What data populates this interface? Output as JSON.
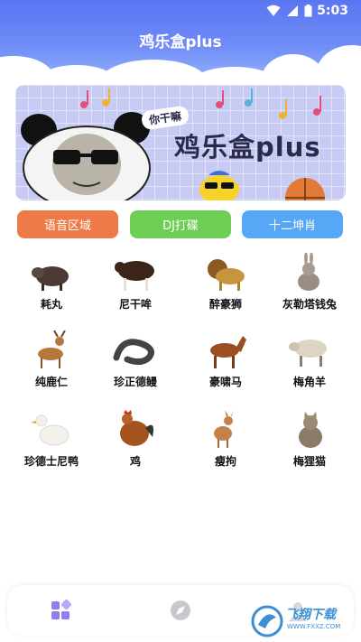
{
  "status": {
    "time": "5:03"
  },
  "header": {
    "title": "鸡乐盒plus"
  },
  "banner": {
    "subtitle": "你干嘛",
    "title": "鸡乐盒plus"
  },
  "categories": [
    {
      "label": "语音区域",
      "color": "#ee7b47"
    },
    {
      "label": "DJ打碟",
      "color": "#6ccf53"
    },
    {
      "label": "十二坤肖",
      "color": "#56a8f6"
    }
  ],
  "animals": [
    {
      "label": "耗丸",
      "icon": "pig-image"
    },
    {
      "label": "尼干哞",
      "icon": "ox-image"
    },
    {
      "label": "醉豪狮",
      "icon": "lion-image"
    },
    {
      "label": "灰勒塔钱兔",
      "icon": "rabbit-image"
    },
    {
      "label": "纯鹿仁",
      "icon": "deer-image"
    },
    {
      "label": "珍正德鳗",
      "icon": "eel-image"
    },
    {
      "label": "豪啸马",
      "icon": "horse-image"
    },
    {
      "label": "梅角羊",
      "icon": "sheep-image"
    },
    {
      "label": "珍德士尼鸭",
      "icon": "duck-image"
    },
    {
      "label": "鸡",
      "icon": "rooster-image"
    },
    {
      "label": "瘦拘",
      "icon": "dog-image"
    },
    {
      "label": "梅狸猫",
      "icon": "cat-image"
    }
  ],
  "tabbar": {
    "tabs": [
      "apps-icon",
      "compass-icon",
      "profile-icon"
    ]
  },
  "watermark": {
    "text": "飞翔下载",
    "url": "WWW.FXXZ.COM"
  }
}
